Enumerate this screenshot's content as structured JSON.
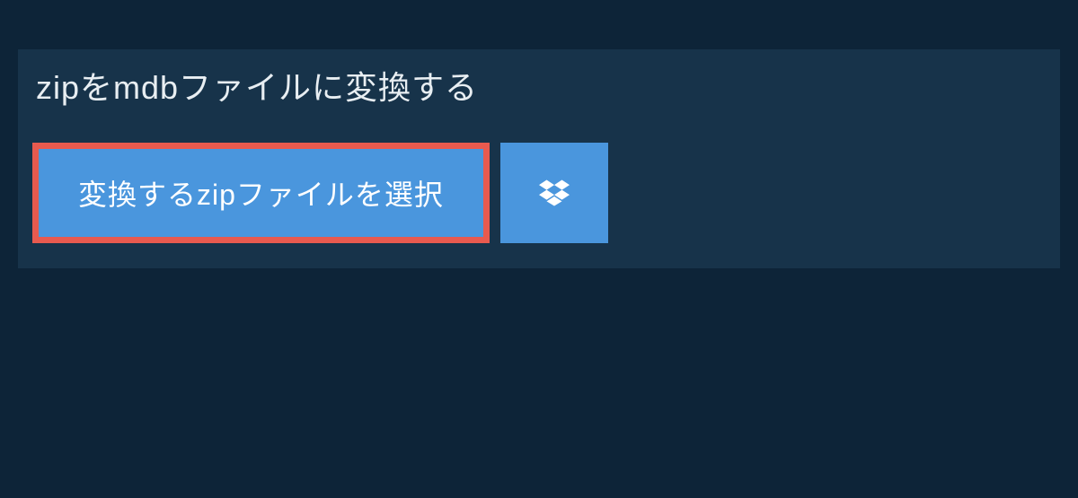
{
  "header": {
    "title": "zipをmdbファイルに変換する"
  },
  "actions": {
    "select_file_label": "変換するzipファイルを選択"
  },
  "icons": {
    "dropbox": "dropbox-icon"
  },
  "colors": {
    "page_bg": "#0d2438",
    "panel_bg": "#17334a",
    "button_bg": "#4a96dd",
    "button_border": "#e85a4f",
    "text_primary": "#e8eef2",
    "text_button": "#ffffff"
  }
}
